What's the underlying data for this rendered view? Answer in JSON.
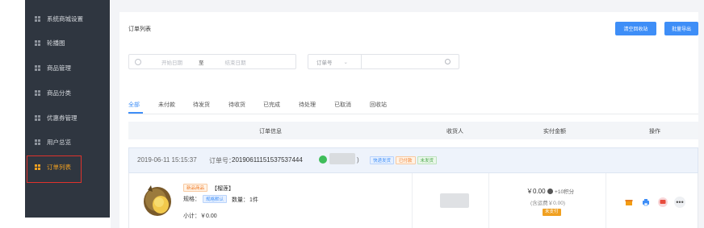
{
  "sidebar": {
    "items": [
      {
        "label": "系统商城设置"
      },
      {
        "label": "轮播图"
      },
      {
        "label": "商品管理"
      },
      {
        "label": "商品分类"
      },
      {
        "label": "优惠券管理"
      },
      {
        "label": "用户总览"
      },
      {
        "label": "订单列表"
      }
    ]
  },
  "toolbar": {
    "title": "订单列表",
    "btn_clear": "清空回收站",
    "btn_export": "批量导出"
  },
  "search": {
    "start_placeholder": "开始日期",
    "range_sep": "至",
    "end_placeholder": "结束日期",
    "select_label": "订单号"
  },
  "tabs": [
    "全部",
    "未付款",
    "待发货",
    "待收货",
    "已完成",
    "待处理",
    "已取消",
    "回收站"
  ],
  "table": {
    "headers": [
      "订单信息",
      "收货人",
      "实付金额",
      "操作"
    ]
  },
  "order": {
    "date": "2019-06-11 15:15:37",
    "order_no_label": "订单号：",
    "order_no": "20190611151537537444",
    "paren": ")",
    "tags": [
      "快递发货",
      "已付款",
      "未发货"
    ],
    "product_tag": "新品商品",
    "product_name": "【榴莲】",
    "spec_label": "规格：",
    "spec_value": "规格默认",
    "qty_label": "数量：",
    "qty_value": "1件",
    "subtotal": "小计：￥0.00",
    "amount": "￥0.00",
    "amount_extra": "+10积分",
    "amount_sub": "(含运费￥0.00)",
    "pay_status": "未支付"
  },
  "colors": {
    "sidebar_bg": "#2f3640",
    "accent": "#3e8ef7",
    "active_side": "#f0a020",
    "highlight": "#e0322c"
  }
}
